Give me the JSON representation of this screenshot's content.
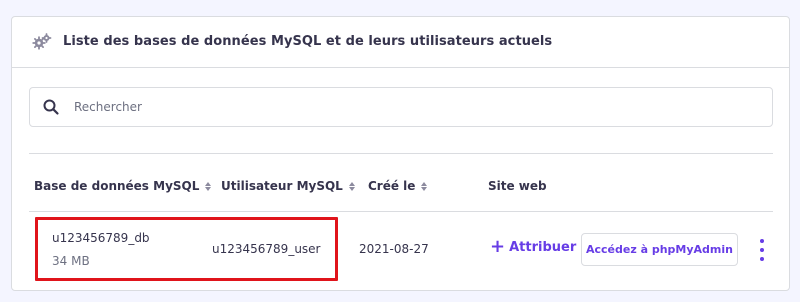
{
  "card": {
    "title": "Liste des bases de données MySQL et de leurs utilisateurs actuels",
    "header_icon": "gears-icon"
  },
  "search": {
    "placeholder": "Rechercher",
    "icon": "search-icon"
  },
  "table": {
    "columns": [
      {
        "label": "Base de données MySQL",
        "sortable": true
      },
      {
        "label": "Utilisateur MySQL",
        "sortable": true
      },
      {
        "label": "Créé le",
        "sortable": true
      },
      {
        "label": "Site web",
        "sortable": false
      }
    ],
    "rows": [
      {
        "database": "u123456789_db",
        "size": "34 MB",
        "user": "u123456789_user",
        "created": "2021-08-27",
        "assign_label": "Attribuer",
        "phpmyadmin_label": "Accédez à phpMyAdmin"
      }
    ]
  },
  "colors": {
    "accent": "#673de6",
    "highlight": "#e0141b",
    "text": "#36344d",
    "border": "#dadce0",
    "page_background": "#f4f5ff"
  }
}
